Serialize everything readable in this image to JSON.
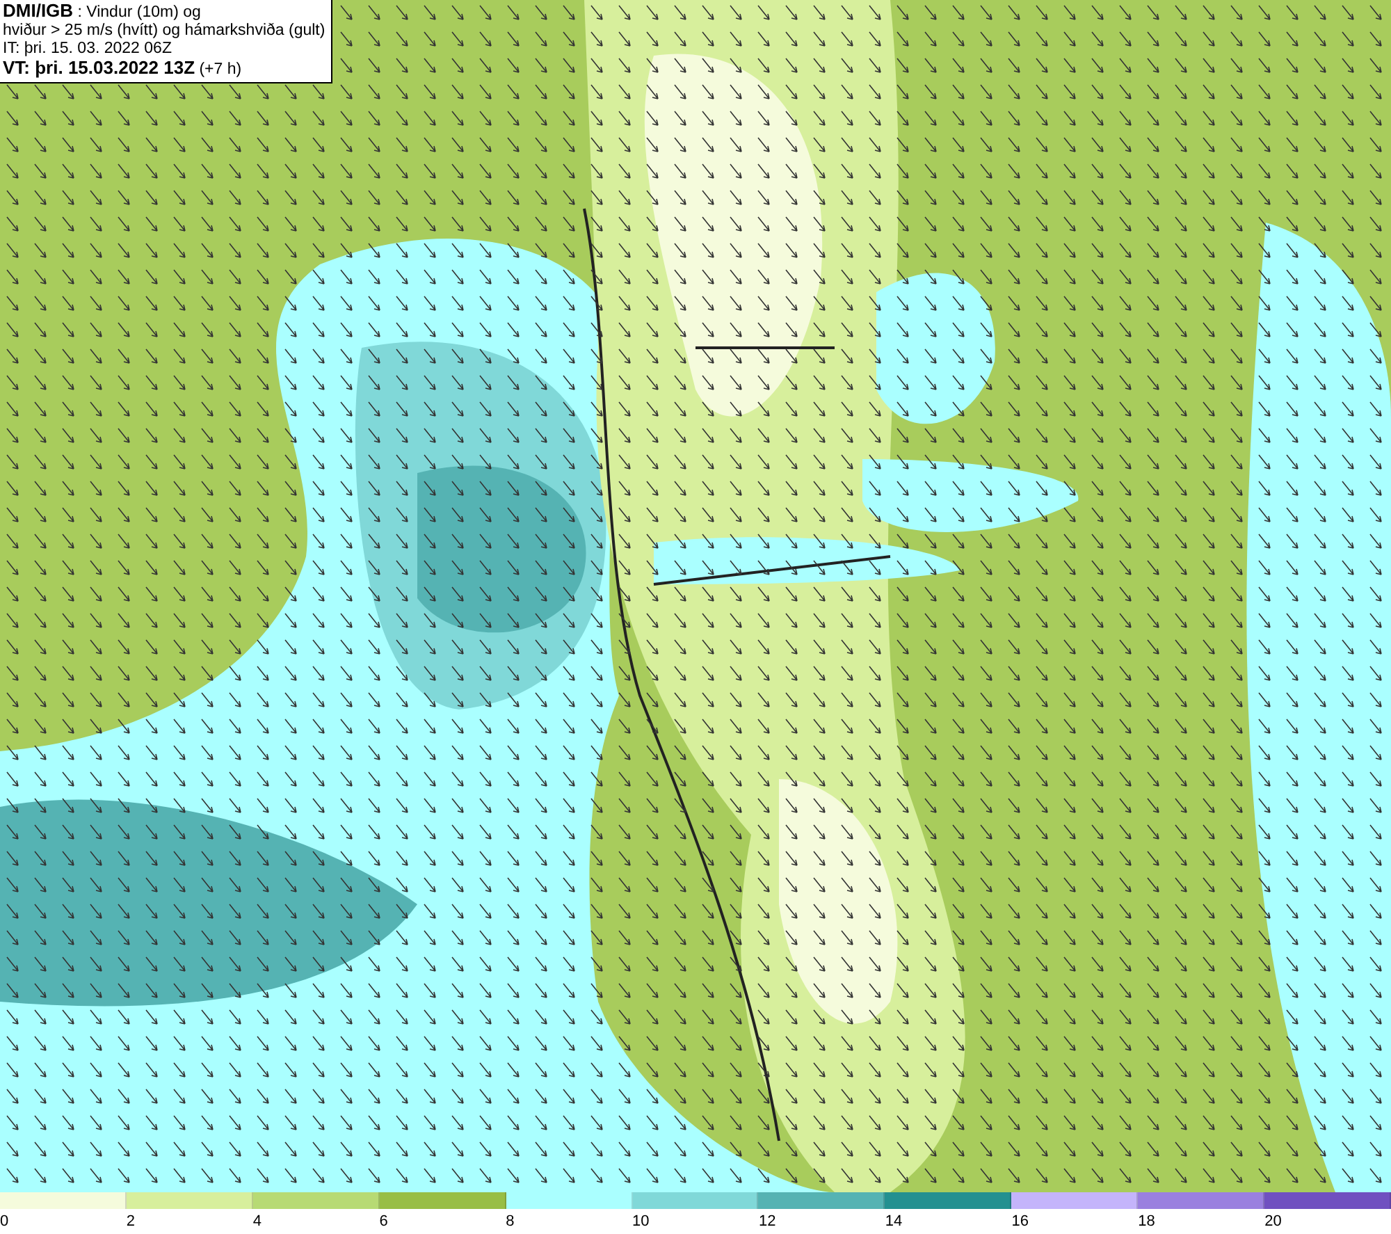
{
  "map": {
    "title_lines": [
      "**DMI/IGB** : Vindur (10m) og",
      "hviður > 25 m/s (hvítt) og hámarkshviða (gult)",
      "IT: þri. 15. 03. 2022 06Z",
      "**VT: þri. 15.03.2022 13Z** (+7 h)"
    ]
  },
  "legend": [
    {
      "label": "0",
      "color": "#f5fbdc"
    },
    {
      "label": "2",
      "color": "#d7ef9c"
    },
    {
      "label": "4",
      "color": "#b7da74"
    },
    {
      "label": "6",
      "color": "#98be45"
    },
    {
      "label": "8",
      "color": "#aaffff"
    },
    {
      "label": "10",
      "color": "#80d8d8"
    },
    {
      "label": "12",
      "color": "#55b3b3"
    },
    {
      "label": "14",
      "color": "#239090"
    },
    {
      "label": "16",
      "color": "#c4b4fb"
    },
    {
      "label": "18",
      "color": "#9a80df"
    },
    {
      "label": "20",
      "color": "#7050c0"
    }
  ]
}
